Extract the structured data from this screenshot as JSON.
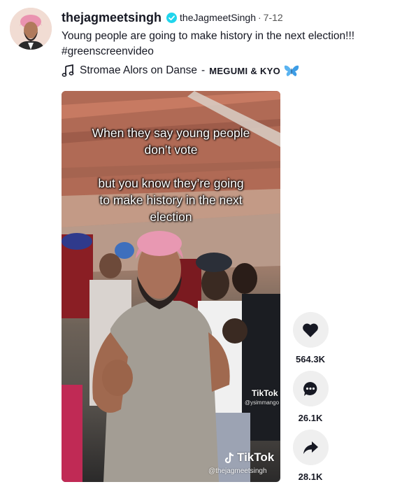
{
  "post": {
    "username": "thejagmeetsingh",
    "nickname": "theJagmeetSingh",
    "date": "7-12",
    "caption": "Young people are going to make history in the next election!!!",
    "hashtag": "#greenscreenvideo"
  },
  "music": {
    "title": "Stromae Alors on Danse",
    "separator": "-",
    "artist": "MEGUMI & KYO",
    "icon": "music-note-icon",
    "emoji": "butterfly-icon"
  },
  "video": {
    "overlay_line1": "When they say young people",
    "overlay_line2": "don’t vote",
    "overlay_line3": "but you know they’re going",
    "overlay_line4": "to make history in the next",
    "overlay_line5": "election",
    "watermark_small_logo": "TikTok",
    "watermark_small_user": "@ysimmango",
    "watermark_logo": "TikTok",
    "watermark_user": "@thejagmeetsingh"
  },
  "actions": {
    "likes": "564.3K",
    "comments": "26.1K",
    "shares": "28.1K"
  },
  "colors": {
    "verified": "#20D5EC",
    "action_bg": "#EFEFEF",
    "text": "#161823"
  }
}
